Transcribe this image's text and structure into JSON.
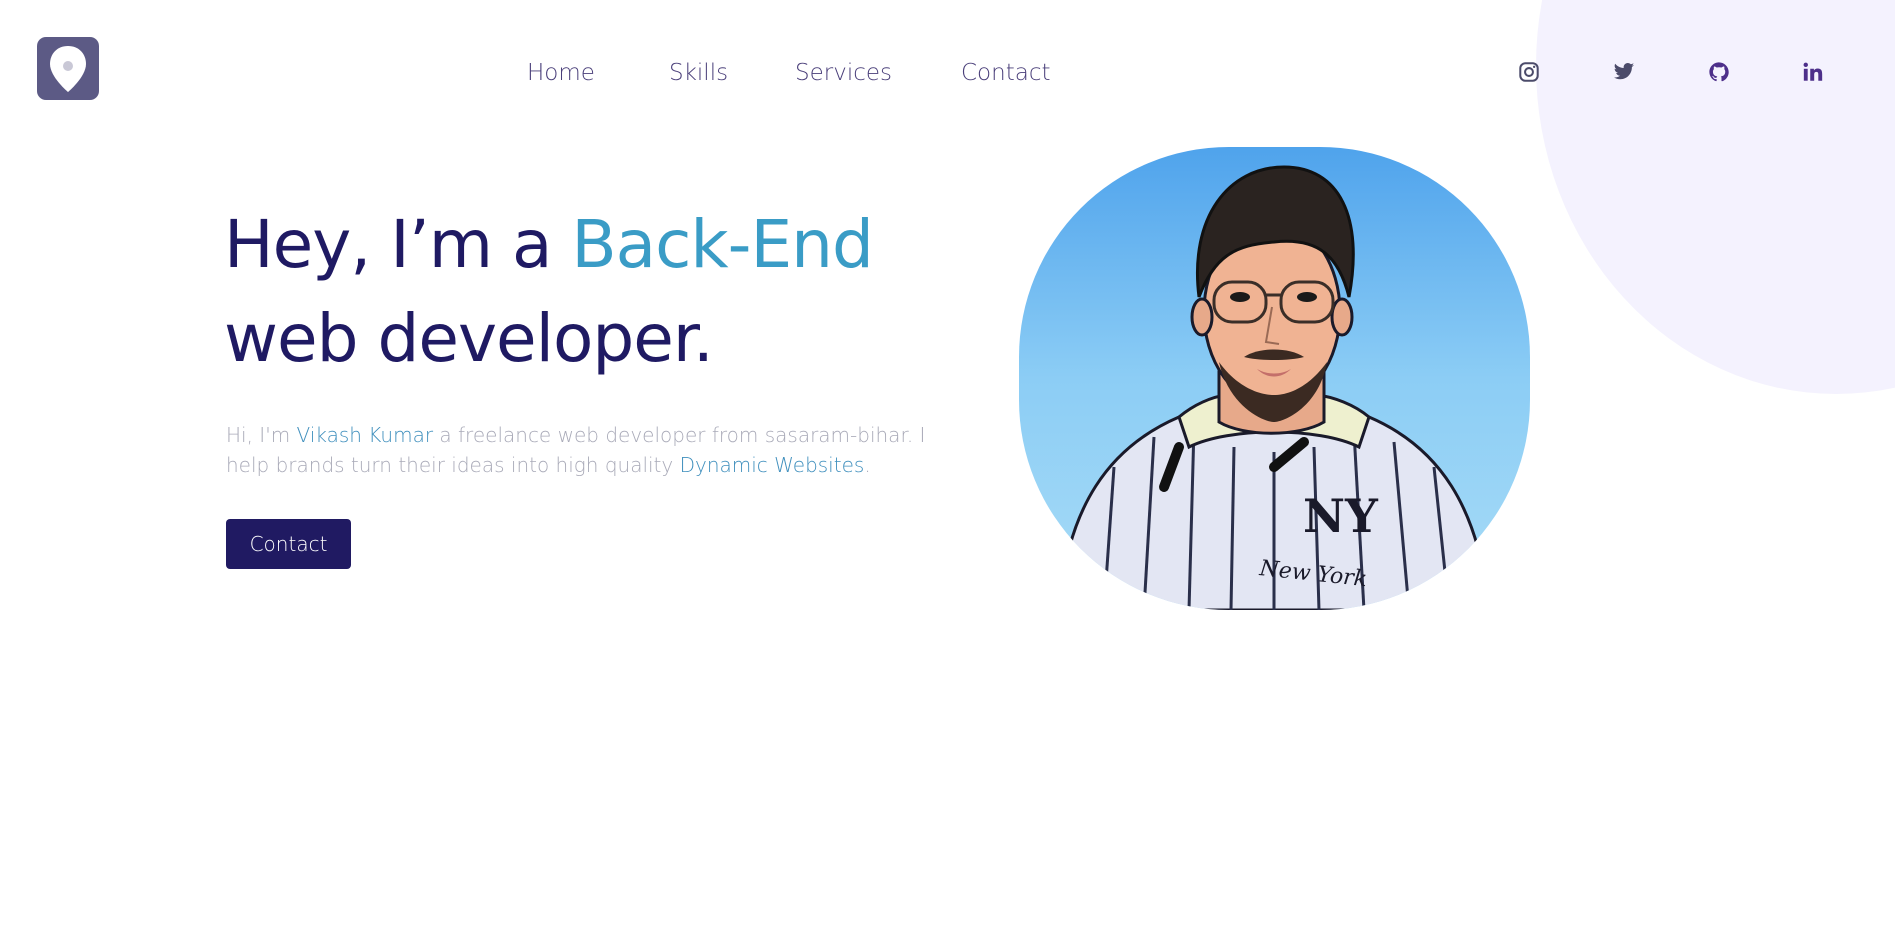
{
  "colors": {
    "brand_dark": "#1f1a63",
    "accent_blue": "#3a9cc6",
    "nav_text": "#4a3f7a",
    "muted_text": "#a9aab8",
    "blob": "#f4f2fe",
    "button_bg": "#201a62",
    "logo_bg": "#5c5a85"
  },
  "header": {
    "logo_icon": "location-pin-icon",
    "nav": [
      {
        "label": "Home"
      },
      {
        "label": "Skills"
      },
      {
        "label": "Services"
      },
      {
        "label": "Contact"
      }
    ],
    "social": [
      {
        "icon": "instagram-icon"
      },
      {
        "icon": "twitter-icon"
      },
      {
        "icon": "github-icon"
      },
      {
        "icon": "linkedin-icon"
      }
    ]
  },
  "hero": {
    "title_part1": "Hey, I’m a ",
    "title_accent": "Back-End",
    "title_line2": "web developer.",
    "desc_1": "Hi, I'm ",
    "desc_name": "Vikash Kumar",
    "desc_2": " a freelance web developer from sasaram-bihar. I help brands turn their ideas into high quality ",
    "desc_highlight": "Dynamic Websites",
    "desc_3": ".",
    "button_label": "Contact"
  },
  "portrait": {
    "shirt_text": "New York",
    "shirt_logo": "NY"
  }
}
